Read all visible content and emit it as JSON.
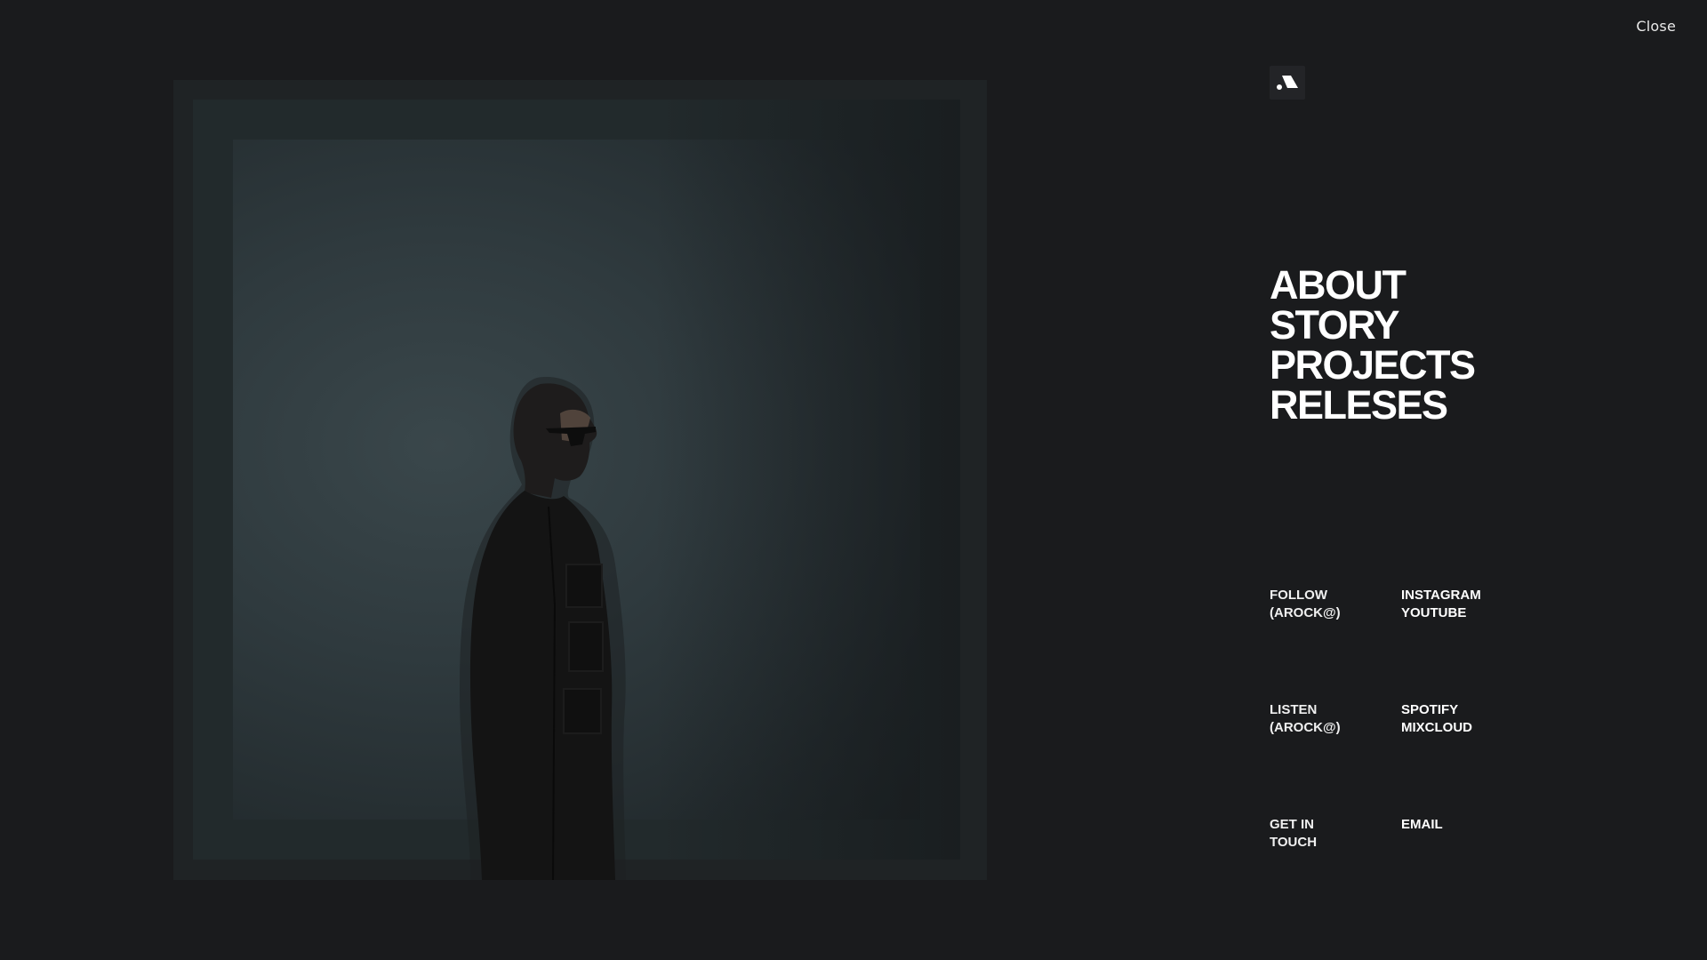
{
  "header": {
    "close_label": "Close"
  },
  "logo": {
    "icon": "brand-logo-icon"
  },
  "nav": {
    "items": [
      {
        "label": "ABOUT"
      },
      {
        "label": "STORY"
      },
      {
        "label": "PROJECTS"
      },
      {
        "label": "RELESES"
      }
    ]
  },
  "groups": {
    "follow": {
      "label_line1": "FOLLOW",
      "label_line2": "(AROCK@)",
      "links": [
        "INSTAGRAM",
        "YOUTUBE"
      ]
    },
    "listen": {
      "label_line1": "LISTEN",
      "label_line2": "(AROCK@)",
      "links": [
        "SPOTIFY",
        "MIXCLOUD"
      ]
    },
    "touch": {
      "label_line1": "GET IN",
      "label_line2": "TOUCH",
      "links": [
        "EMAIL"
      ]
    }
  },
  "colors": {
    "background": "#1a1b1d",
    "text": "#ffffff",
    "photo_backdrop": "#2f3a3e"
  }
}
